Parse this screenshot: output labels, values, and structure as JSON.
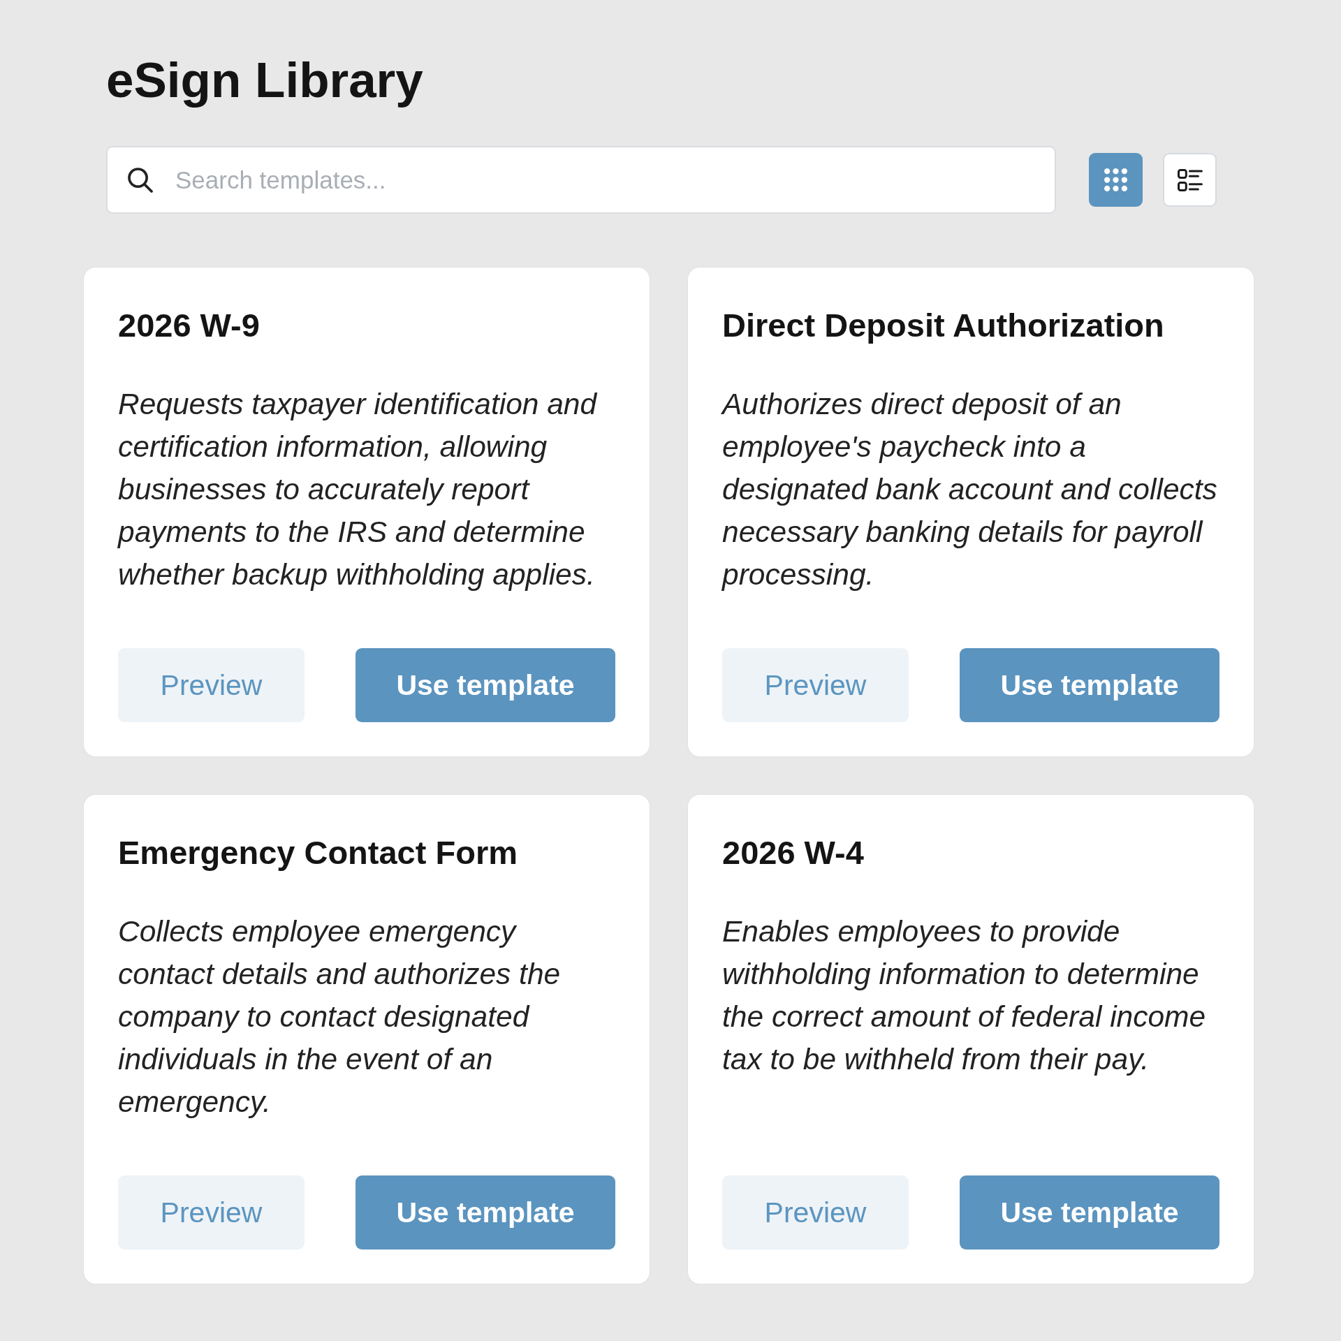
{
  "title": "eSign Library",
  "search": {
    "placeholder": "Search templates..."
  },
  "view_toggle": [
    {
      "kind": "grid",
      "selected": true
    },
    {
      "kind": "list",
      "selected": false
    }
  ],
  "templates": [
    {
      "title": "2026 W-9",
      "description": "Requests taxpayer identification and certification information, allowing businesses to accurately report payments to the IRS and determine whether backup withholding applies.",
      "actions": [
        {
          "kind": "secondary",
          "label": "Preview"
        },
        {
          "kind": "primary",
          "label": "Use template"
        }
      ]
    },
    {
      "title": "Direct Deposit Authorization",
      "description": "Authorizes direct deposit of an employee's paycheck into a designated bank account and collects necessary banking details for payroll processing.",
      "actions": [
        {
          "kind": "secondary",
          "label": "Preview"
        },
        {
          "kind": "primary",
          "label": "Use template"
        }
      ]
    },
    {
      "title": "Emergency Contact Form",
      "description": "Collects employee emergency contact details and authorizes the company to contact designated individuals in the event of an emergency.",
      "actions": [
        {
          "kind": "secondary",
          "label": "Preview"
        },
        {
          "kind": "primary",
          "label": "Use template"
        }
      ]
    },
    {
      "title": "2026 W-4",
      "description": "Enables employees to provide withholding information to determine the correct amount of federal income tax to be withheld from their pay.",
      "actions": [
        {
          "kind": "secondary",
          "label": "Preview"
        },
        {
          "kind": "primary",
          "label": "Use template"
        }
      ]
    }
  ]
}
